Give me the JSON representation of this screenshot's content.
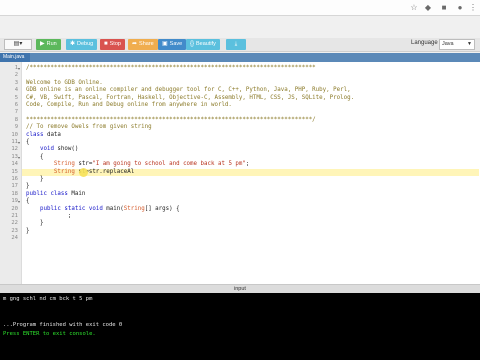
{
  "toolbar": {
    "run": "Run",
    "debug": "Debug",
    "stop": "Stop",
    "share": "Share",
    "save": "Save",
    "beautify": "Beautify",
    "language_label": "Language",
    "language_value": "Java",
    "colors": {
      "run": "#5cb85c",
      "debug": "#5bc0de",
      "stop": "#d9534f",
      "share": "#f0ad4e",
      "save": "#428bca",
      "beautify": "#5bc0de",
      "download": "#5bc0de"
    }
  },
  "file_tab": {
    "label": "Main.java"
  },
  "editor": {
    "lines": [
      {
        "n": "1",
        "parts": [
          {
            "t": "/**********************************************************************************",
            "c": "cmt"
          }
        ]
      },
      {
        "n": "2",
        "parts": []
      },
      {
        "n": "3",
        "parts": [
          {
            "t": "Welcome to GDB Online.",
            "c": "cmt"
          }
        ]
      },
      {
        "n": "4",
        "parts": [
          {
            "t": "GDB online is an online compiler and debugger tool for C, C++, Python, Java, PHP, Ruby, Perl,",
            "c": "cmt"
          }
        ]
      },
      {
        "n": "5",
        "parts": [
          {
            "t": "C#, VB, Swift, Pascal, Fortran, Haskell, Objective-C, Assembly, HTML, CSS, JS, SQLite, Prolog.",
            "c": "cmt"
          }
        ]
      },
      {
        "n": "6",
        "parts": [
          {
            "t": "Code, Compile, Run and Debug online from anywhere in world.",
            "c": "cmt"
          }
        ]
      },
      {
        "n": "7",
        "parts": []
      },
      {
        "n": "8",
        "parts": [
          {
            "t": "**********************************************************************************/",
            "c": "cmt"
          }
        ]
      },
      {
        "n": "9",
        "parts": [
          {
            "t": "// To remove Owels from given string",
            "c": "cmt"
          }
        ]
      },
      {
        "n": "10",
        "parts": [
          {
            "t": "class ",
            "c": "kw"
          },
          {
            "t": "data",
            "c": ""
          }
        ]
      },
      {
        "n": "11",
        "parts": [
          {
            "t": "{",
            "c": ""
          }
        ]
      },
      {
        "n": "12",
        "parts": [
          {
            "t": "    ",
            "c": ""
          },
          {
            "t": "void ",
            "c": "kw"
          },
          {
            "t": "show()",
            "c": ""
          }
        ]
      },
      {
        "n": "13",
        "parts": [
          {
            "t": "    {",
            "c": ""
          }
        ]
      },
      {
        "n": "14",
        "parts": [
          {
            "t": "        ",
            "c": ""
          },
          {
            "t": "String ",
            "c": "ty"
          },
          {
            "t": "str=",
            "c": ""
          },
          {
            "t": "\"I am going to school and come back at 5 pm\"",
            "c": "str"
          },
          {
            "t": ";",
            "c": ""
          }
        ]
      },
      {
        "n": "15",
        "parts": [
          {
            "t": "        ",
            "c": ""
          },
          {
            "t": "String ",
            "c": "ty"
          },
          {
            "t": "st=str.replaceAl",
            "c": ""
          }
        ]
      },
      {
        "n": "16",
        "parts": [
          {
            "t": "    }",
            "c": ""
          }
        ]
      },
      {
        "n": "17",
        "parts": [
          {
            "t": "}",
            "c": ""
          }
        ]
      },
      {
        "n": "18",
        "parts": [
          {
            "t": "public ",
            "c": "kw"
          },
          {
            "t": "class ",
            "c": "kw"
          },
          {
            "t": "Main",
            "c": ""
          }
        ]
      },
      {
        "n": "19",
        "parts": [
          {
            "t": "{",
            "c": ""
          }
        ]
      },
      {
        "n": "20",
        "parts": [
          {
            "t": "    ",
            "c": ""
          },
          {
            "t": "public ",
            "c": "kw"
          },
          {
            "t": "static ",
            "c": "kw"
          },
          {
            "t": "void ",
            "c": "kw"
          },
          {
            "t": "main(",
            "c": ""
          },
          {
            "t": "String",
            "c": "ty"
          },
          {
            "t": "[] args) {",
            "c": ""
          }
        ]
      },
      {
        "n": "21",
        "parts": [
          {
            "t": "            ;",
            "c": ""
          }
        ]
      },
      {
        "n": "22",
        "parts": [
          {
            "t": "    }",
            "c": ""
          }
        ]
      },
      {
        "n": "23",
        "parts": [
          {
            "t": "}",
            "c": ""
          }
        ]
      },
      {
        "n": "24",
        "parts": []
      }
    ]
  },
  "divider": {
    "label": "input"
  },
  "console": {
    "lines": [
      {
        "t": "m gng schl nd cm bck t 5 pm",
        "color": "#e8e8e8"
      },
      {
        "t": "",
        "color": "#e8e8e8"
      },
      {
        "t": "",
        "color": "#e8e8e8"
      },
      {
        "t": "...Program finished with exit code 0",
        "color": "#e8e8e8"
      },
      {
        "t": "Press ENTER to exit console.",
        "color": "#2ee62e"
      }
    ]
  }
}
